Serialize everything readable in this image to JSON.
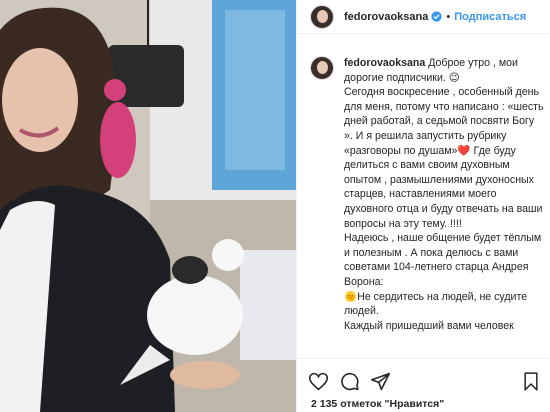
{
  "post": {
    "username": "fedorovaoksana",
    "follow_label": "Подписаться",
    "dot": "•",
    "caption": {
      "username": "fedorovaoksana",
      "text": " Доброе утро , мои дорогие подписчики. 😉\nСегодня воскресение , особенный день для меня, потому что написано : «шесть дней работай, а седьмой посвяти Богу ». И я решила запустить рубрику «разговоры по душам»❤️ Где буду делиться с вами своим духовным опытом , размышлениями духоносных старцев, наставлениями моего духовного отца и буду отвечать на ваши вопросы на эту тему. !!!!\nНадеюсь , наше общение будет тёплым и полезным . А пока делюсь с вами советами 104-летнего старца Андрея Ворона:\n🌞Не сердитесь на людей, не судите людей.\nКаждый пришедший вами человек"
    },
    "likes_text": "2 135 отметок \"Нравится\""
  },
  "icons": {
    "verified": "verified-badge-icon",
    "like": "heart-icon",
    "comment": "comment-icon",
    "share": "share-icon",
    "save": "bookmark-icon"
  },
  "colors": {
    "accent": "#3897f0",
    "text": "#262626",
    "border": "#efefef"
  }
}
